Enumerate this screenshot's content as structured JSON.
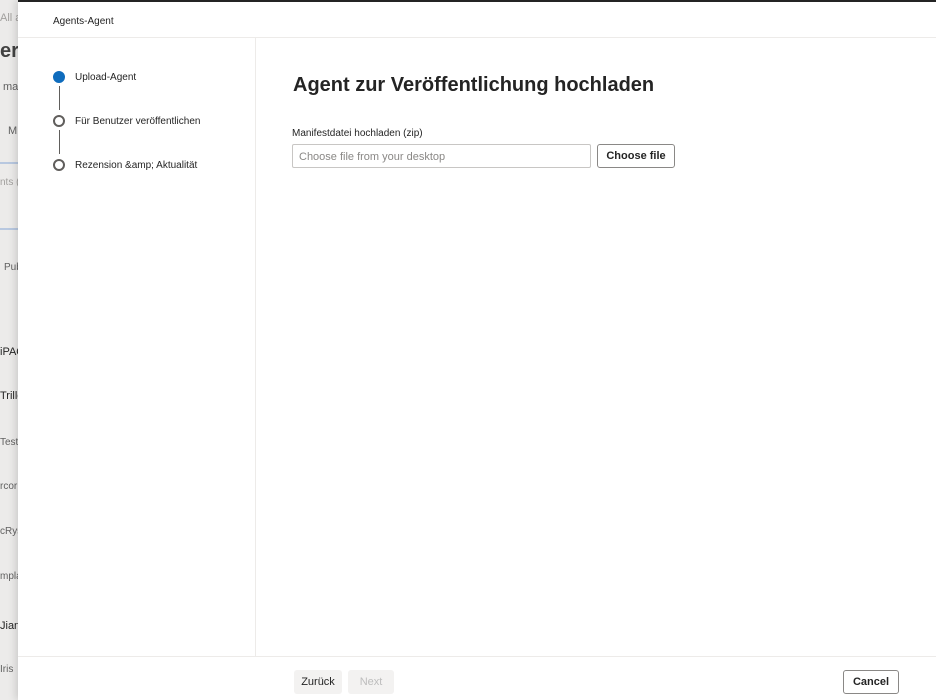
{
  "background": {
    "fragments": [
      "All ag",
      "er",
      "ma",
      "M",
      "nts (",
      "Pub",
      "iPAQ",
      "Triller",
      "Test",
      "rcor",
      "cRys",
      "mpla",
      "Jian",
      "Iris"
    ]
  },
  "panel": {
    "title": "Agents-Agent"
  },
  "steps": [
    {
      "label": "Upload-Agent",
      "state": "active"
    },
    {
      "label": "Für Benutzer veröffentlichen",
      "state": "pending"
    },
    {
      "label": "Rezension &amp; Aktualität",
      "state": "pending"
    }
  ],
  "main": {
    "heading": "Agent zur Veröffentlichung hochladen",
    "manifest_label": "Manifestdatei hochladen (zip)",
    "file_placeholder": "Choose file from your desktop",
    "choose_file_label": "Choose file"
  },
  "footer": {
    "back_label": "Zurück",
    "next_label": "Next",
    "cancel_label": "Cancel"
  },
  "colors": {
    "accent": "#0f6cbd"
  }
}
